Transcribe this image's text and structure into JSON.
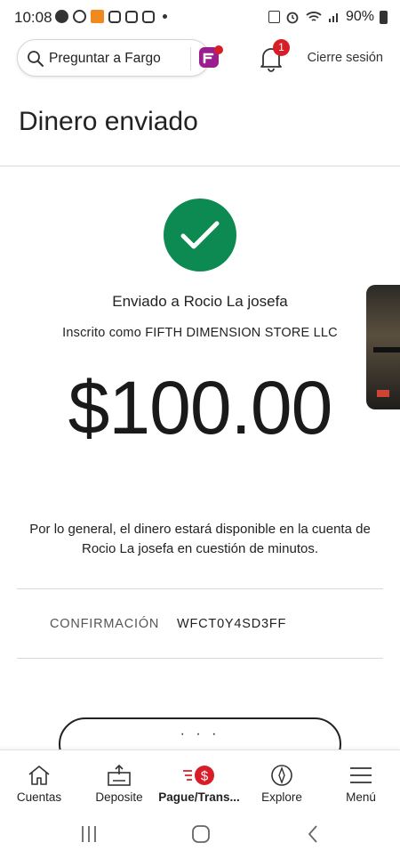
{
  "status_bar": {
    "time": "10:08",
    "battery": "90%"
  },
  "header": {
    "ask_label": "Preguntar a Fargo",
    "notifications_count": "1",
    "signout_label": "Cierre sesión"
  },
  "page": {
    "title": "Dinero enviado"
  },
  "transfer": {
    "sent_to": "Enviado a Rocio La josefa",
    "enrolled_as": "Inscrito como FIFTH DIMENSION STORE LLC",
    "amount": "$100.00",
    "notice": "Por lo general, el dinero estará disponible en la cuenta de Rocio La josefa en cuestión de minutos.",
    "confirmation_label": "CONFIRMACIÓN",
    "confirmation_value": "WFCT0Y4SD3FF"
  },
  "bottom_nav": {
    "items": [
      {
        "label": "Cuentas",
        "icon": "home-icon"
      },
      {
        "label": "Deposite",
        "icon": "deposit-icon"
      },
      {
        "label": "Pague/Trans...",
        "icon": "pay-transfer-icon"
      },
      {
        "label": "Explore",
        "icon": "compass-icon"
      },
      {
        "label": "Menú",
        "icon": "hamburger-icon"
      }
    ]
  },
  "colors": {
    "success": "#0d8a52",
    "badge": "#d71e28",
    "fargo_purple": "#9b1d8e"
  }
}
